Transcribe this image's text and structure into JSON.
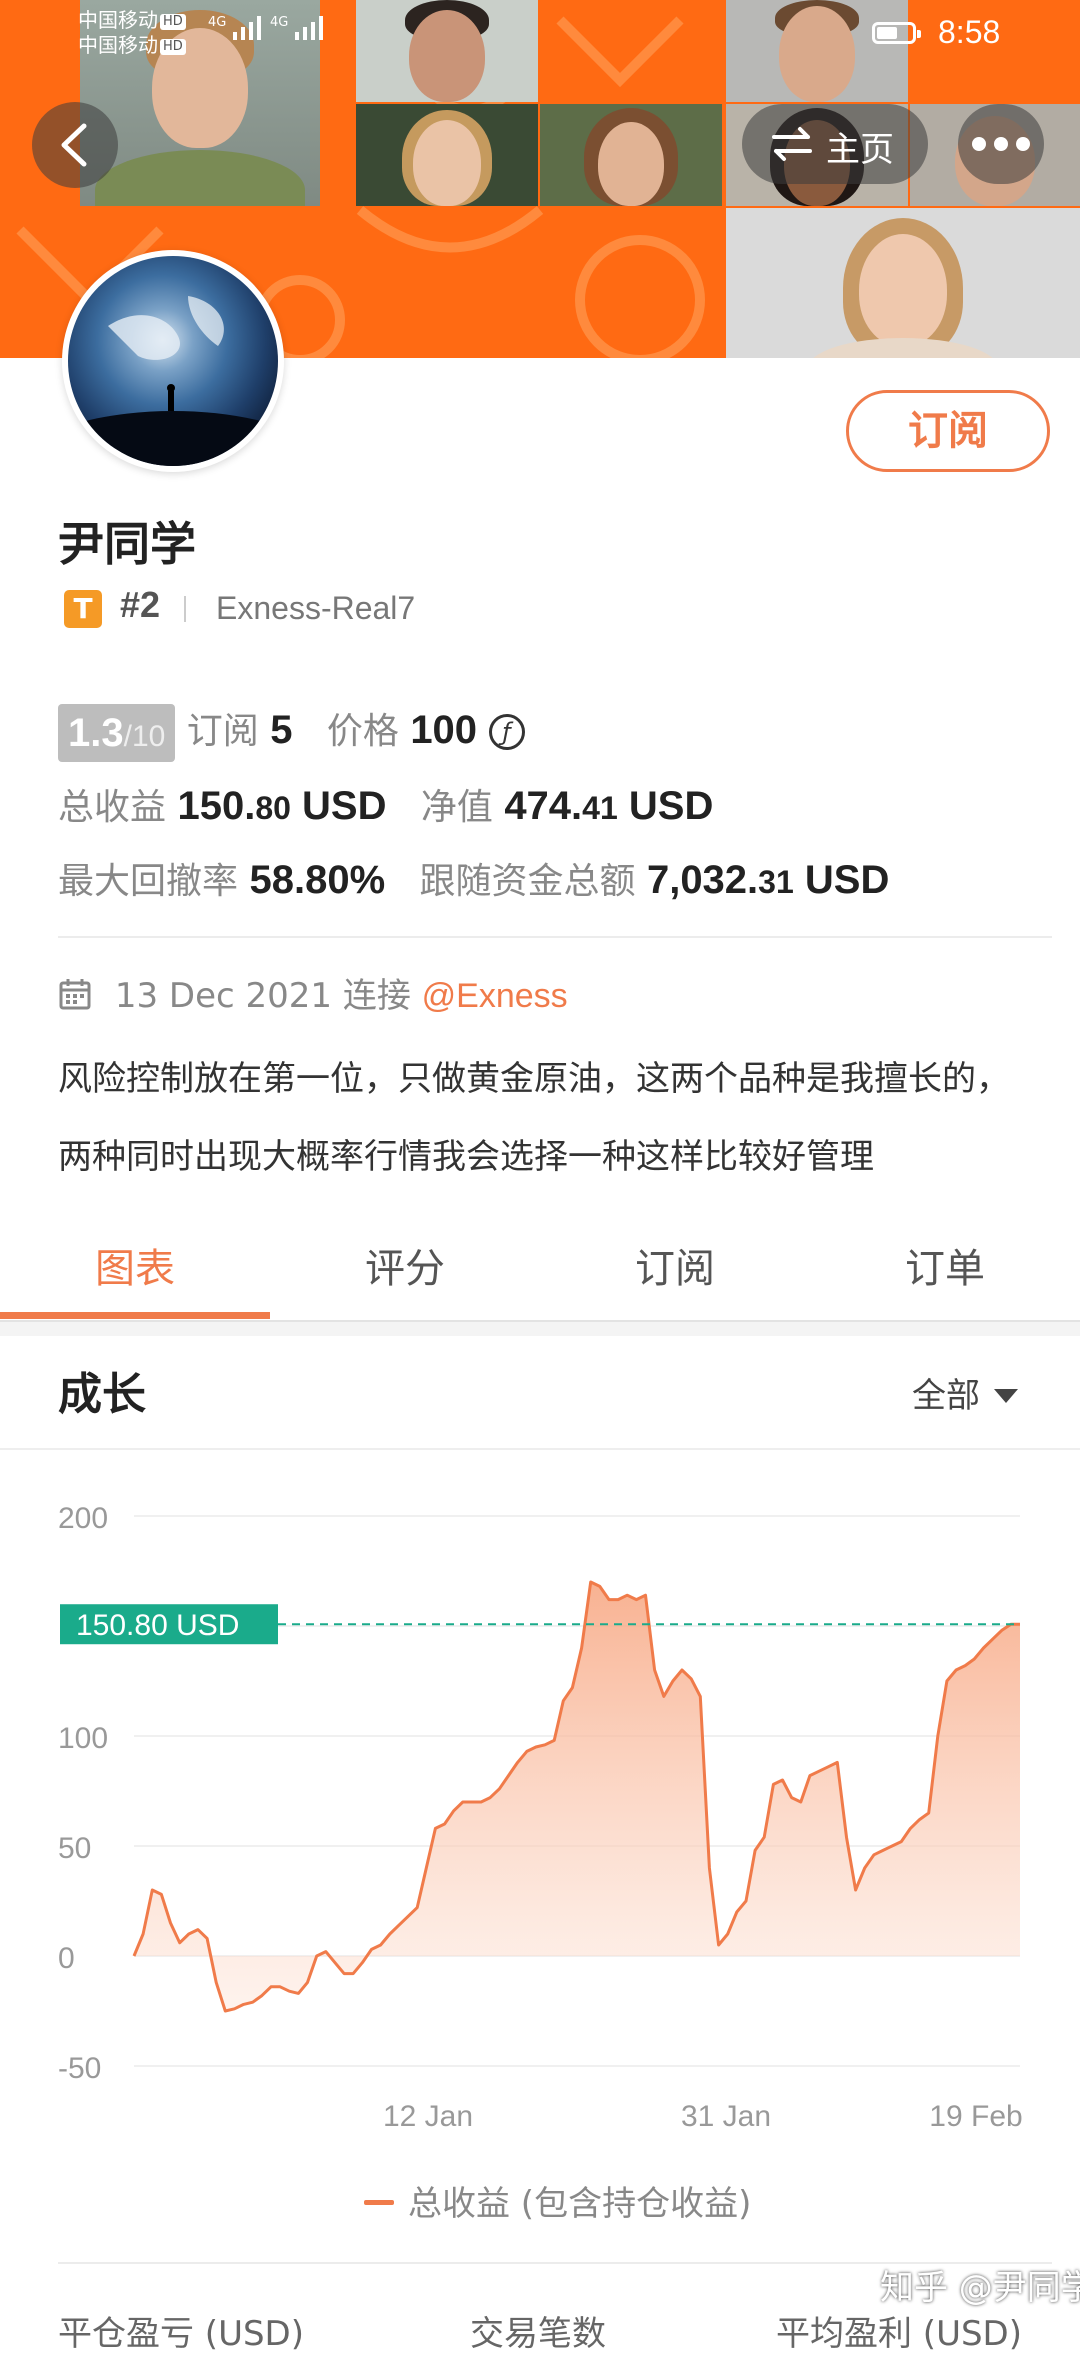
{
  "status_bar": {
    "carrier_1": "中国移动",
    "carrier_2": "中国移动",
    "hd": "HD",
    "network": "4G",
    "time": "8:58",
    "battery_level": 0.6
  },
  "header": {
    "home_label": "主页"
  },
  "profile": {
    "name": "尹同学",
    "badge": "T",
    "rank": "#2",
    "server": "Exness-Real7",
    "subscribe_label": "订阅",
    "rating_value": "1.3",
    "rating_max": "/10",
    "subs_label": "订阅",
    "subs_count": "5",
    "price_label": "价格",
    "price_value": "100",
    "coin_symbol": "ƒ",
    "total_profit_label": "总收益",
    "total_profit_int": "150.",
    "total_profit_dec": "80",
    "total_profit_unit": " USD",
    "equity_label": "净值",
    "equity_int": "474.",
    "equity_dec": "41",
    "equity_unit": " USD",
    "max_dd_label": "最大回撤率",
    "max_dd_value": "58.80%",
    "follow_label": "跟随资金总额",
    "follow_int": "7,032.",
    "follow_dec": "31",
    "follow_unit": " USD",
    "date": "13 Dec 2021",
    "connect_label": "连接",
    "broker_link": "@Exness",
    "description": "风险控制放在第一位，只做黄金原油，这两个品种是我擅长的，两种同时出现大概率行情我会选择一种这样比较好管理"
  },
  "tabs": [
    {
      "label": "图表",
      "active": true
    },
    {
      "label": "评分",
      "active": false
    },
    {
      "label": "订阅",
      "active": false
    },
    {
      "label": "订单",
      "active": false
    }
  ],
  "growth": {
    "title": "成长",
    "filter_label": "全部"
  },
  "chart_data": {
    "type": "area",
    "ylim": [
      -50,
      200
    ],
    "yticks": [
      200,
      100,
      50,
      0,
      -50
    ],
    "xtick_labels": [
      "12 Jan",
      "31 Jan",
      "19 Feb"
    ],
    "current_label": "150.80 USD",
    "current_value": 150.8,
    "legend": "总收益 (包含持仓收益)",
    "series": [
      {
        "values": [
          0,
          10,
          30,
          28,
          15,
          6,
          10,
          12,
          8,
          -12,
          -25,
          -24,
          -22,
          -21,
          -18,
          -14,
          -14,
          -16,
          -17,
          -12,
          0,
          2,
          -3,
          -8,
          -8,
          -3,
          3,
          5,
          10,
          14,
          18,
          22,
          40,
          58,
          60,
          66,
          70,
          70,
          70,
          72,
          76,
          82,
          88,
          93,
          95,
          96,
          98,
          116,
          122,
          140,
          170,
          168,
          162,
          162,
          164,
          162,
          164,
          130,
          118,
          125,
          130,
          126,
          118,
          40,
          5,
          10,
          20,
          25,
          48,
          54,
          78,
          80,
          72,
          70,
          82,
          84,
          86,
          88,
          54,
          30,
          40,
          46,
          48,
          50,
          52,
          58,
          62,
          65,
          100,
          125,
          130,
          132,
          135,
          140,
          144,
          148,
          150.8,
          150.8
        ]
      }
    ]
  },
  "bottom": {
    "col1": "平仓盈亏 (USD)",
    "col2": "交易笔数",
    "col3": "平均盈利 (USD)"
  },
  "watermark": "知乎 @尹同学",
  "colors": {
    "accent": "#f07b4a",
    "banner": "#ff6a13",
    "teal": "#1aab8b"
  }
}
